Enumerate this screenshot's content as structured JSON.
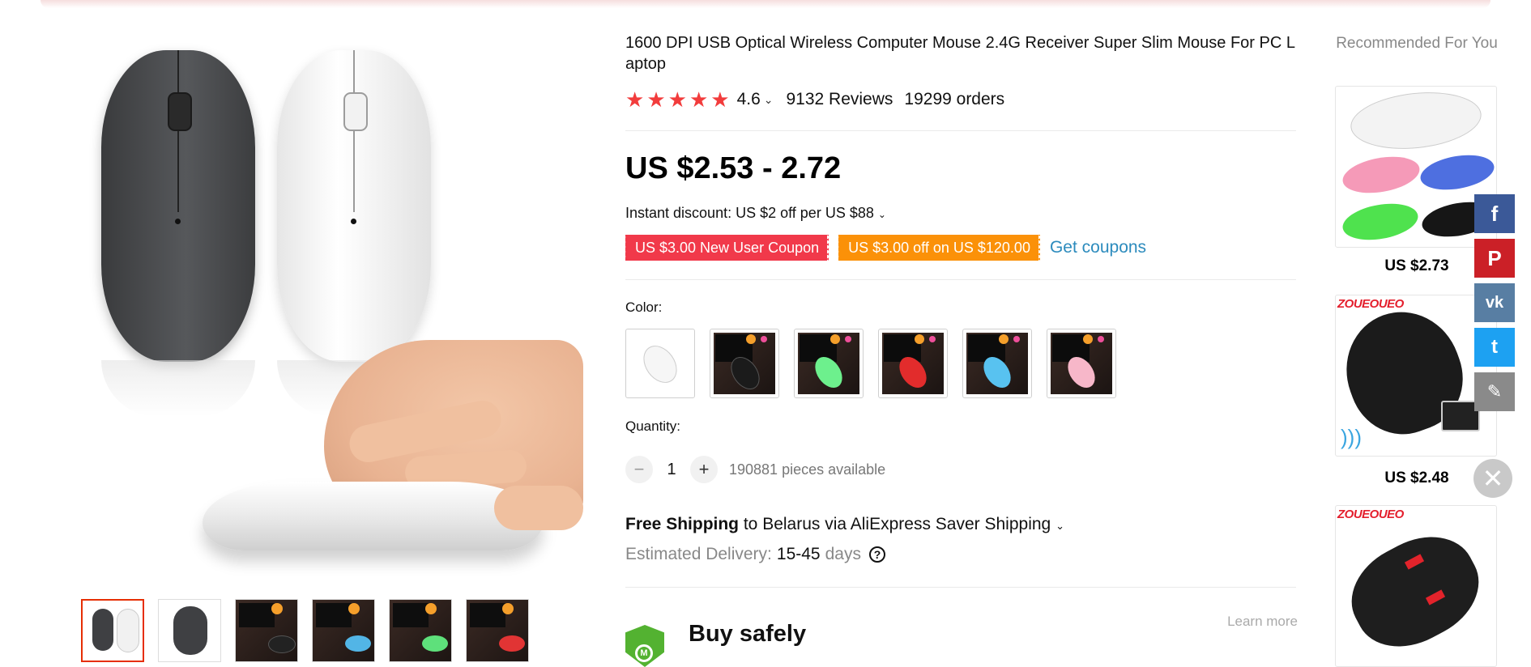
{
  "product": {
    "title": "1600 DPI USB Optical Wireless Computer Mouse 2.4G Receiver Super Slim Mouse For PC Laptop",
    "rating": "4.6",
    "reviews": "9132 Reviews",
    "orders": "19299 orders",
    "price": "US $2.53 - 2.72",
    "discount": "Instant discount: US $2 off per US $88",
    "coupons": [
      "US $3.00 New User Coupon",
      "US $3.00 off on US $120.00"
    ],
    "get_coupons": "Get coupons",
    "color_label": "Color:",
    "quantity_label": "Quantity:",
    "quantity": "1",
    "available": "190881 pieces available",
    "shipping_bold": "Free Shipping",
    "shipping_rest": " to Belarus via AliExpress Saver Shipping",
    "eta_label": "Estimated Delivery:",
    "eta_value": "15-45",
    "eta_unit": "days",
    "buy_safely": "Buy safely",
    "learn_more": "Learn more",
    "colors": [
      "white",
      "black",
      "green",
      "red",
      "blue",
      "pink"
    ]
  },
  "recommended": {
    "title": "Recommended For You",
    "items": [
      {
        "price": "US $2.73"
      },
      {
        "price": "US $2.48",
        "brand": "ZOUEOUEO"
      },
      {
        "brand": "ZOUEOUEO"
      }
    ]
  },
  "share": [
    "facebook-icon",
    "pinterest-icon",
    "vk-icon",
    "twitter-icon",
    "edit-icon"
  ],
  "colors": {
    "accent_red": "#f1394a",
    "accent_orange": "#fb9108",
    "link_blue": "#2c8bbd",
    "star_red": "#f23c3c"
  }
}
